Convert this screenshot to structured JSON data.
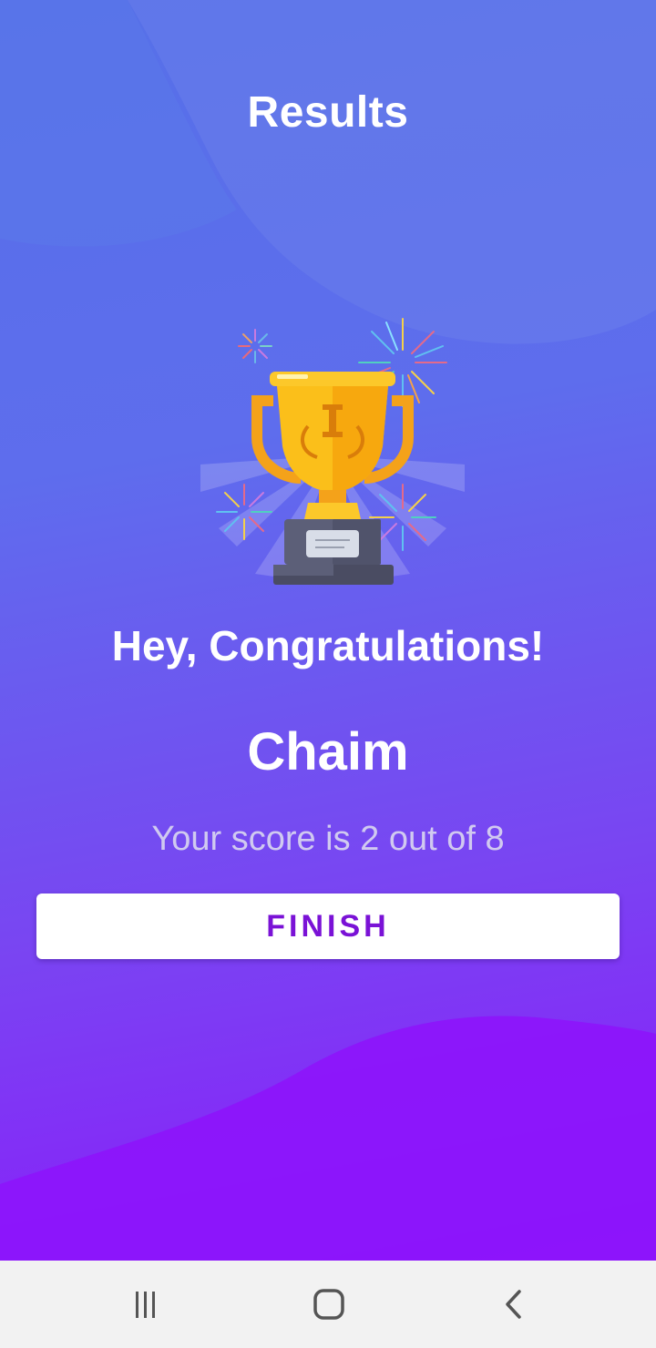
{
  "screen": {
    "title": "Results",
    "congratulations": "Hey, Congratulations!",
    "player_name": "Chaim",
    "score_text": "Your score is 2 out of 8",
    "finish_label": "FINISH"
  },
  "trophy": {
    "badge_letter": "I"
  },
  "colors": {
    "gradient_top": "#5670e8",
    "gradient_bottom": "#8b17fb",
    "button_text": "#7a12d6",
    "trophy_gold": "#fbbf1a"
  },
  "navbar": {
    "items": [
      {
        "name": "recent-apps",
        "icon": "recent-apps-icon"
      },
      {
        "name": "home",
        "icon": "home-icon"
      },
      {
        "name": "back",
        "icon": "back-icon"
      }
    ]
  }
}
